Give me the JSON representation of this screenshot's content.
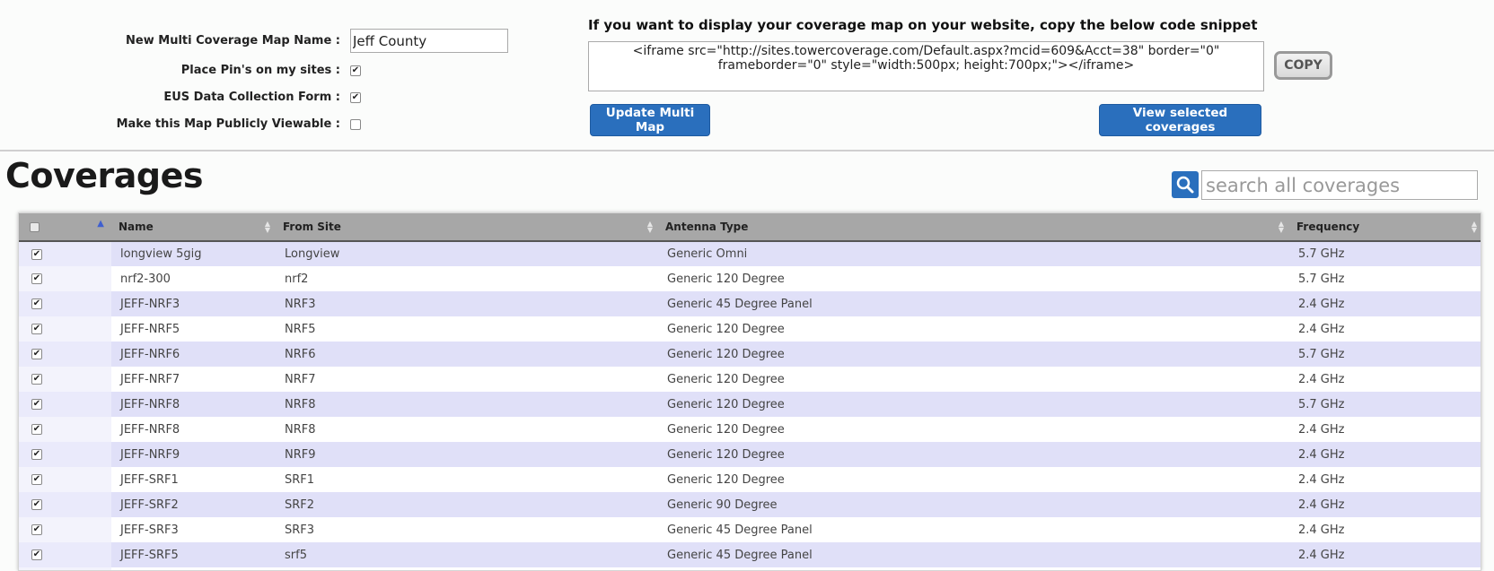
{
  "form": {
    "map_name_label": "New Multi Coverage Map Name :",
    "map_name_value": "Jeff County",
    "place_pins_label": "Place Pin's on my sites :",
    "place_pins_checked": "✔",
    "eus_label": "EUS Data Collection Form :",
    "eus_checked": "✔",
    "public_label": "Make this Map Publicly Viewable :",
    "public_checked": ""
  },
  "snippet": {
    "heading": "If you want to display your coverage map on your website, copy the below code snippet",
    "code": "<iframe src=\"http://sites.towercoverage.com/Default.aspx?mcid=609&Acct=38\"  border=\"0\" frameborder=\"0\" style=\"width:500px; height:700px;\"></iframe>",
    "copy_label": "COPY"
  },
  "buttons": {
    "update_label": "Update Multi Map",
    "view_label": "View selected coverages"
  },
  "coverages": {
    "title": "Coverages",
    "search_placeholder": "search all coverages",
    "columns": [
      "Name",
      "From Site",
      "Antenna Type",
      "Frequency"
    ],
    "check_mark": "✔",
    "rows": [
      {
        "name": "longview 5gig",
        "site": "Longview",
        "antenna": "Generic Omni",
        "freq": "5.7 GHz"
      },
      {
        "name": "nrf2-300",
        "site": "nrf2",
        "antenna": "Generic 120 Degree",
        "freq": "5.7 GHz"
      },
      {
        "name": "JEFF-NRF3",
        "site": "NRF3",
        "antenna": "Generic 45 Degree Panel",
        "freq": "2.4 GHz"
      },
      {
        "name": "JEFF-NRF5",
        "site": "NRF5",
        "antenna": "Generic 120 Degree",
        "freq": "2.4 GHz"
      },
      {
        "name": "JEFF-NRF6",
        "site": "NRF6",
        "antenna": "Generic 120 Degree",
        "freq": "5.7 GHz"
      },
      {
        "name": "JEFF-NRF7",
        "site": "NRF7",
        "antenna": "Generic 120 Degree",
        "freq": "2.4 GHz"
      },
      {
        "name": "JEFF-NRF8",
        "site": "NRF8",
        "antenna": "Generic 120 Degree",
        "freq": "5.7 GHz"
      },
      {
        "name": "JEFF-NRF8",
        "site": "NRF8",
        "antenna": "Generic 120 Degree",
        "freq": "2.4 GHz"
      },
      {
        "name": "JEFF-NRF9",
        "site": "NRF9",
        "antenna": "Generic 120 Degree",
        "freq": "2.4 GHz"
      },
      {
        "name": "JEFF-SRF1",
        "site": "SRF1",
        "antenna": "Generic 120 Degree",
        "freq": "2.4 GHz"
      },
      {
        "name": "JEFF-SRF2",
        "site": "SRF2",
        "antenna": "Generic 90 Degree",
        "freq": "2.4 GHz"
      },
      {
        "name": "JEFF-SRF3",
        "site": "SRF3",
        "antenna": "Generic 45 Degree Panel",
        "freq": "2.4 GHz"
      },
      {
        "name": "JEFF-SRF5",
        "site": "srf5",
        "antenna": "Generic 45 Degree Panel",
        "freq": "2.4 GHz"
      },
      {
        "name": "",
        "site": "",
        "antenna": "",
        "freq": ""
      }
    ]
  },
  "icons": {
    "search": "search-icon",
    "sort": "sort-icon"
  },
  "colors": {
    "accent": "#2a6fbd",
    "header_bg": "#a7a7a7",
    "row_alt": "#e0e0f8"
  }
}
